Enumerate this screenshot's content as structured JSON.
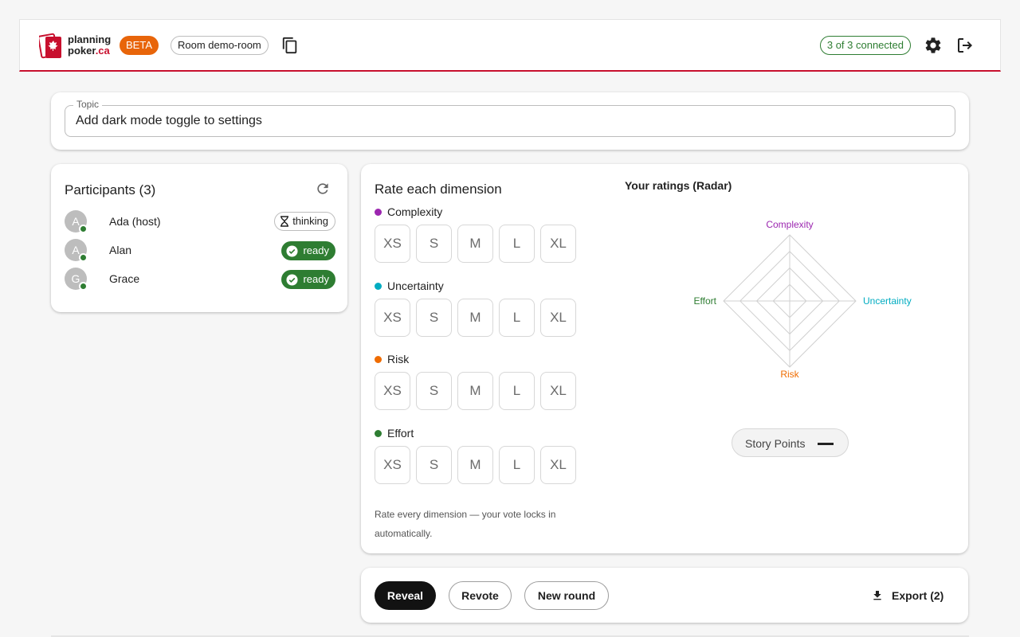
{
  "header": {
    "brand_line1": "planning",
    "brand_line2": "poker",
    "brand_suffix": ".ca",
    "beta": "BETA",
    "room": "Room demo-room",
    "connected": "3 of 3 connected",
    "accent_color": "#c8102e",
    "icons": [
      "maple-leaf-card-logo",
      "copy-icon",
      "gear-icon",
      "logout-icon"
    ]
  },
  "topic": {
    "label": "Topic",
    "value": "Add dark mode toggle to settings"
  },
  "participants": {
    "title": "Participants (3)",
    "list": [
      {
        "initial": "A",
        "name": "Ada (host)",
        "status": "thinking"
      },
      {
        "initial": "A",
        "name": "Alan",
        "status": "ready"
      },
      {
        "initial": "G",
        "name": "Grace",
        "status": "ready"
      }
    ]
  },
  "rating": {
    "title": "Rate each dimension",
    "sizes": [
      "XS",
      "S",
      "M",
      "L",
      "XL"
    ],
    "dimensions": [
      {
        "name": "Complexity",
        "color": "#9c27b0"
      },
      {
        "name": "Uncertainty",
        "color": "#00acc1"
      },
      {
        "name": "Risk",
        "color": "#ef6c00"
      },
      {
        "name": "Effort",
        "color": "#2e7d32"
      }
    ],
    "hint": "Rate every dimension — your vote locks in automatically."
  },
  "radar": {
    "title": "Your ratings (Radar)",
    "axes": [
      {
        "label": "Complexity",
        "color": "#9c27b0"
      },
      {
        "label": "Uncertainty",
        "color": "#00acc1"
      },
      {
        "label": "Risk",
        "color": "#ef6c00"
      },
      {
        "label": "Effort",
        "color": "#2e7d32"
      }
    ],
    "rings": 4,
    "story_points_label": "Story Points"
  },
  "actions": {
    "reveal": "Reveal",
    "revote": "Revote",
    "new_round": "New round",
    "export": "Export (2)"
  }
}
